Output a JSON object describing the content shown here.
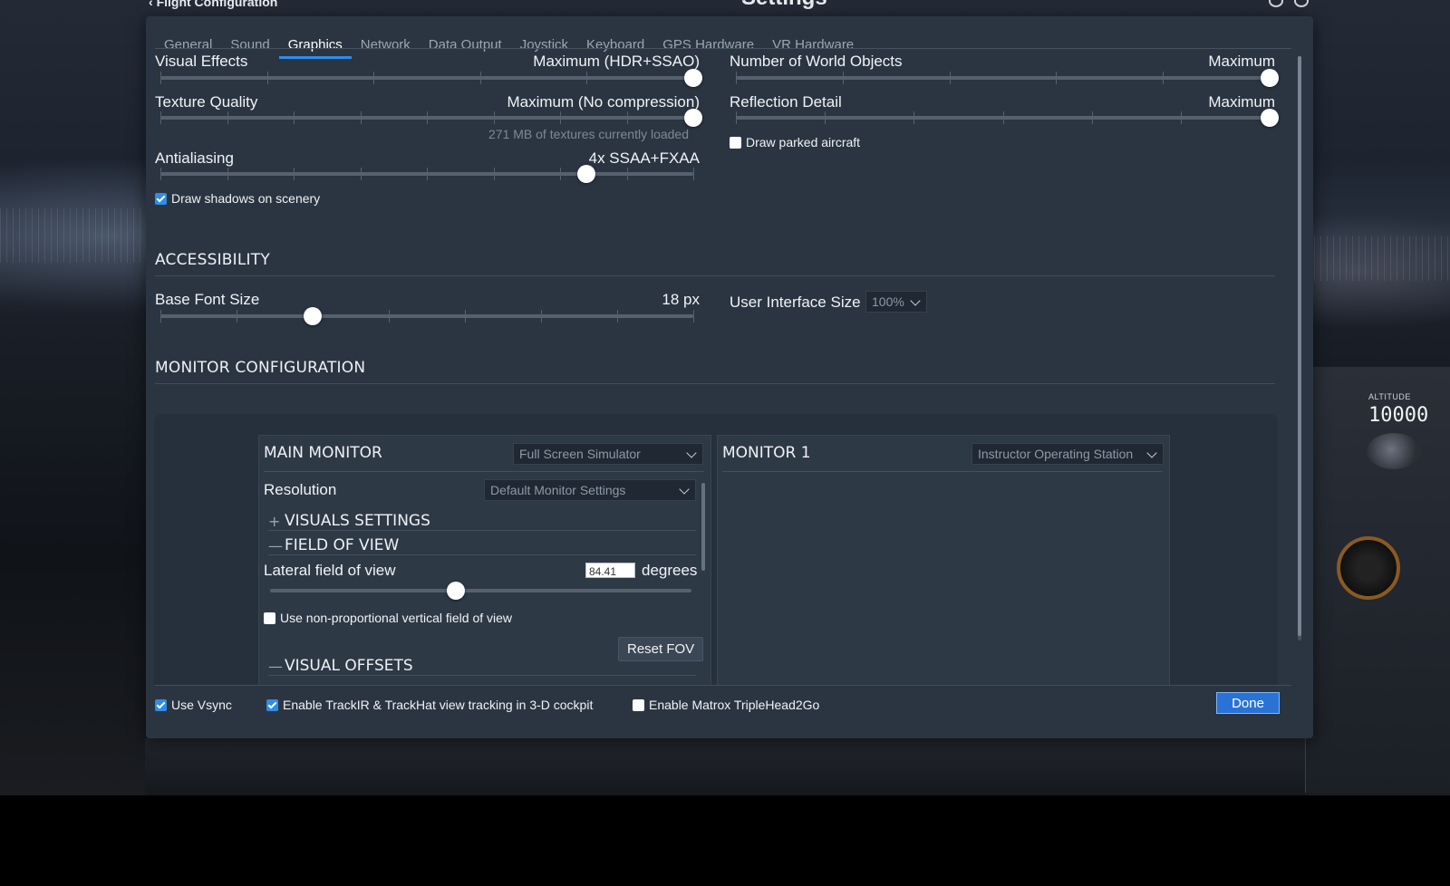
{
  "window": {
    "back_link": "Flight Configuration",
    "title": "Settings"
  },
  "tabs": [
    {
      "label": "General"
    },
    {
      "label": "Sound"
    },
    {
      "label": "Graphics",
      "active": true
    },
    {
      "label": "Network"
    },
    {
      "label": "Data Output"
    },
    {
      "label": "Joystick"
    },
    {
      "label": "Keyboard"
    },
    {
      "label": "GPS Hardware"
    },
    {
      "label": "VR Hardware"
    }
  ],
  "graphics": {
    "visual_effects": {
      "label": "Visual Effects",
      "value": "Maximum (HDR+SSAO)",
      "level": 1.0
    },
    "texture_quality": {
      "label": "Texture Quality",
      "value": "Maximum (No compression)",
      "level": 1.0,
      "note": "271 MB of textures currently loaded"
    },
    "antialiasing": {
      "label": "Antialiasing",
      "value": "4x SSAA+FXAA",
      "level": 0.8
    },
    "draw_shadows": {
      "label": "Draw shadows on scenery",
      "checked": true
    },
    "world_objects": {
      "label": "Number of World Objects",
      "value": "Maximum",
      "level": 1.0
    },
    "reflection_detail": {
      "label": "Reflection Detail",
      "value": "Maximum",
      "level": 1.0
    },
    "draw_parked_aircraft": {
      "label": "Draw parked aircraft",
      "checked": false
    }
  },
  "accessibility": {
    "title": "ACCESSIBILITY",
    "base_font_size": {
      "label": "Base Font Size",
      "value": "18 px",
      "level": 0.286
    },
    "ui_size": {
      "label": "User Interface Size",
      "value": "100%"
    }
  },
  "monitor_config": {
    "title": "MONITOR CONFIGURATION",
    "main_monitor": {
      "title": "MAIN MONITOR",
      "mode": "Full Screen Simulator",
      "resolution_label": "Resolution",
      "resolution_value": "Default Monitor Settings",
      "visuals_settings": "VISUALS SETTINGS",
      "field_of_view": "FIELD OF VIEW",
      "lateral_fov_label": "Lateral field of view",
      "lateral_fov_value": "84.41",
      "lateral_fov_unit": "degrees",
      "lateral_fov_level": 0.44,
      "non_proportional": {
        "label": "Use non-proportional vertical field of view",
        "checked": false
      },
      "reset_fov": "Reset FOV",
      "visual_offsets": "VISUAL OFFSETS",
      "expand_symbol": "+",
      "collapse_symbol": "—"
    },
    "monitor_1": {
      "title": "MONITOR 1",
      "mode": "Instructor Operating Station"
    }
  },
  "footer": {
    "vsync": {
      "label": "Use Vsync",
      "checked": true
    },
    "trackir": {
      "label": "Enable TrackIR & TrackHat view tracking in 3-D cockpit",
      "checked": true
    },
    "matrox": {
      "label": "Enable Matrox TripleHead2Go",
      "checked": false
    },
    "done": "Done"
  },
  "cockpit": {
    "altitude_label": "ALTITUDE",
    "altitude_value": "10000"
  },
  "colors": {
    "accent": "#2e8de8",
    "dialog_bg": "#2b3542",
    "done_button": "#2a73d6"
  }
}
